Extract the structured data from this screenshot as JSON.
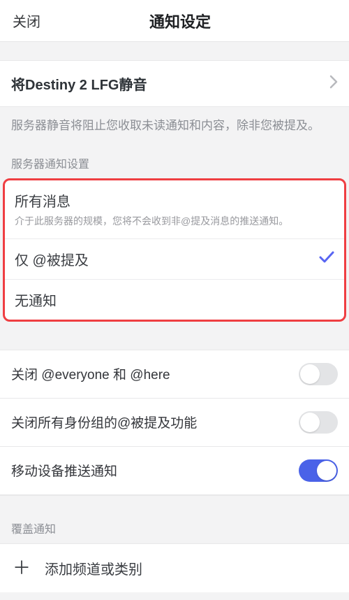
{
  "header": {
    "close": "关闭",
    "title": "通知设定"
  },
  "mute": {
    "label": "将Destiny 2 LFG静音",
    "desc": "服务器静音将阻止您收取未读通知和内容，除非您被提及。"
  },
  "notifSection": {
    "label": "服务器通知设置",
    "options": [
      {
        "label": "所有消息",
        "sub": "介于此服务器的规模，您将不会收到非@提及消息的推送通知。"
      },
      {
        "label": "仅 @被提及"
      },
      {
        "label": "无通知"
      }
    ],
    "selectedIndex": 1
  },
  "toggles": [
    {
      "label": "关闭 @everyone 和 @here",
      "on": false
    },
    {
      "label": "关闭所有身份组的@被提及功能",
      "on": false
    },
    {
      "label": "移动设备推送通知",
      "on": true
    }
  ],
  "override": {
    "label": "覆盖通知",
    "add": "添加频道或类别"
  }
}
